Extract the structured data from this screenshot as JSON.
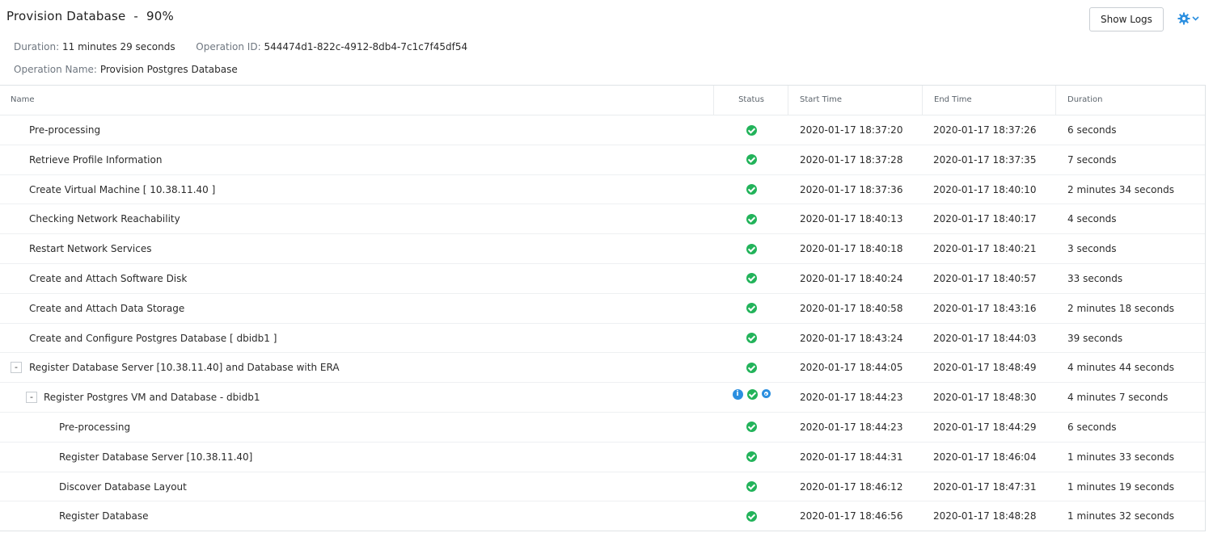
{
  "header": {
    "title": "Provision Database",
    "progress_text": "90%",
    "duration_label": "Duration:",
    "duration_value": "11 minutes 29 seconds",
    "operation_id_label": "Operation ID:",
    "operation_id_value": "544474d1-822c-4912-8db4-7c1c7f45df54",
    "operation_name_label": "Operation Name:",
    "operation_name_value": "Provision Postgres Database",
    "show_logs_label": "Show Logs"
  },
  "colors": {
    "success": "#22b35a",
    "info": "#2b8fe0",
    "gear": "#2b8fe0"
  },
  "table": {
    "columns": {
      "name": "Name",
      "status": "Status",
      "start": "Start Time",
      "end": "End Time",
      "duration": "Duration"
    },
    "rows": [
      {
        "name": "Pre-processing",
        "start": "2020-01-17 18:37:20",
        "end": "2020-01-17 18:37:26",
        "duration": "6 seconds"
      },
      {
        "name": "Retrieve Profile Information",
        "start": "2020-01-17 18:37:28",
        "end": "2020-01-17 18:37:35",
        "duration": "7 seconds"
      },
      {
        "name": "Create Virtual Machine [ 10.38.11.40 ]",
        "start": "2020-01-17 18:37:36",
        "end": "2020-01-17 18:40:10",
        "duration": "2 minutes 34 seconds"
      },
      {
        "name": "Checking Network Reachability",
        "start": "2020-01-17 18:40:13",
        "end": "2020-01-17 18:40:17",
        "duration": "4 seconds"
      },
      {
        "name": "Restart Network Services",
        "start": "2020-01-17 18:40:18",
        "end": "2020-01-17 18:40:21",
        "duration": "3 seconds"
      },
      {
        "name": "Create and Attach Software Disk",
        "start": "2020-01-17 18:40:24",
        "end": "2020-01-17 18:40:57",
        "duration": "33 seconds"
      },
      {
        "name": "Create and Attach Data Storage",
        "start": "2020-01-17 18:40:58",
        "end": "2020-01-17 18:43:16",
        "duration": "2 minutes 18 seconds"
      },
      {
        "name": "Create and Configure Postgres Database [ dbidb1 ]",
        "start": "2020-01-17 18:43:24",
        "end": "2020-01-17 18:44:03",
        "duration": "39 seconds"
      },
      {
        "name": "Register Database Server [10.38.11.40] and Database with ERA",
        "start": "2020-01-17 18:44:05",
        "end": "2020-01-17 18:48:49",
        "duration": "4 minutes 44 seconds",
        "toggle": "-"
      },
      {
        "name": "Register Postgres VM and Database - dbidb1",
        "start": "2020-01-17 18:44:23",
        "end": "2020-01-17 18:48:30",
        "duration": "4 minutes 7 seconds",
        "toggle": "-"
      },
      {
        "name": "Pre-processing",
        "start": "2020-01-17 18:44:23",
        "end": "2020-01-17 18:44:29",
        "duration": "6 seconds"
      },
      {
        "name": "Register Database Server [10.38.11.40]",
        "start": "2020-01-17 18:44:31",
        "end": "2020-01-17 18:46:04",
        "duration": "1 minutes 33 seconds"
      },
      {
        "name": "Discover Database Layout",
        "start": "2020-01-17 18:46:12",
        "end": "2020-01-17 18:47:31",
        "duration": "1 minutes 19 seconds"
      },
      {
        "name": "Register Database",
        "start": "2020-01-17 18:46:56",
        "end": "2020-01-17 18:48:28",
        "duration": "1 minutes 32 seconds"
      }
    ]
  }
}
